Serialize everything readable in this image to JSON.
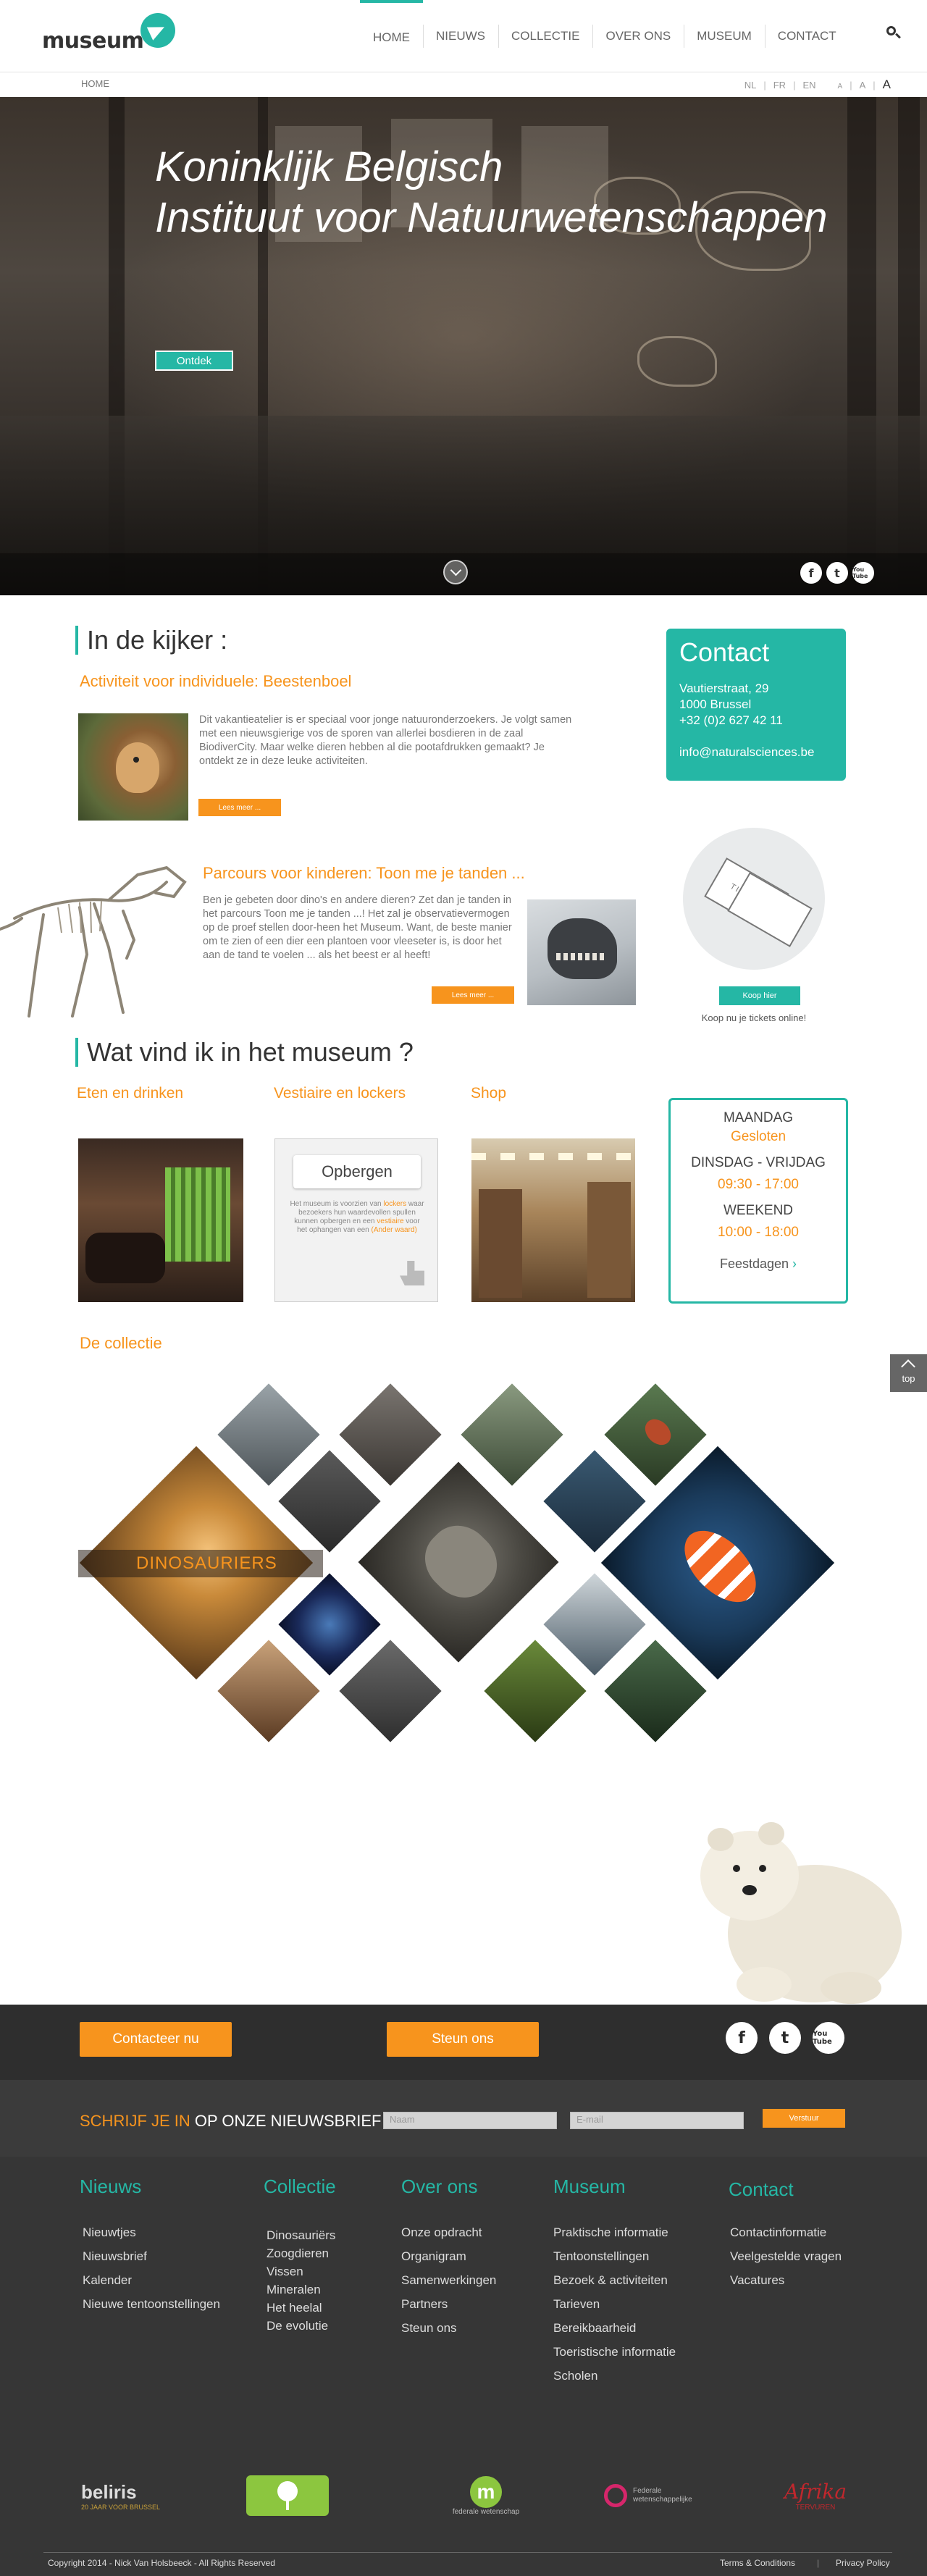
{
  "header": {
    "logo_text": "museum",
    "nav": [
      "HOME",
      "NIEUWS",
      "COLLECTIE",
      "OVER ONS",
      "MUSEUM",
      "CONTACT"
    ],
    "active_nav": "HOME",
    "search_icon": "search-icon"
  },
  "subbar": {
    "breadcrumb": "HOME",
    "langs": [
      "NL",
      "FR",
      "EN"
    ],
    "font_sizes": [
      "A",
      "A",
      "A"
    ]
  },
  "hero": {
    "title_line1": "Koninklijk Belgisch",
    "title_line2": "Instituut voor Natuurwetenschappen",
    "button": "Ontdek",
    "social": [
      "f",
      "t",
      "You Tube"
    ]
  },
  "kijker": {
    "title": "In de kijker :",
    "items": [
      {
        "title": "Activiteit voor individuele: Beestenboel",
        "text": "Dit vakantieatelier is er speciaal voor jonge natuuronderzoekers. Je volgt samen met een nieuwsgierige vos de sporen van allerlei bosdieren in de zaal BiodiverCity. Maar welke dieren hebben al die pootafdrukken gemaakt? Je ontdekt ze in deze leuke activiteiten.",
        "button": "Lees meer ..."
      },
      {
        "title": "Parcours voor kinderen: Toon me je tanden ...",
        "text": "Ben je gebeten door dino's en andere dieren? Zet dan je tanden in het parcours Toon me je tanden ...! Het zal je observatievermogen op de proef stellen door-heen het Museum. Want, de beste manier om te zien of een dier een plantoen voor vleeseter is, is door het aan de tand te voelen ... als het beest er al heeft!",
        "button": "Lees meer ..."
      }
    ]
  },
  "contact": {
    "title": "Contact",
    "street": "Vautierstraat, 29",
    "city": "1000 Brussel",
    "phone": "+32 (0)2 627 42 11",
    "email": "info@naturalsciences.be"
  },
  "tickets": {
    "ticket_text": "TICKET",
    "button": "Koop hier",
    "note": "Koop nu je tickets online!"
  },
  "museum_section": {
    "title": "Wat vind ik in het museum ?",
    "categories": [
      "Eten en drinken",
      "Vestiaire en lockers",
      "Shop"
    ],
    "locker_title": "Opbergen",
    "locker_text_1": "Het museum is voorzien van",
    "locker_text_2": "lockers",
    "locker_text_3": "waar bezoekers hun waardevollen spullen kunnen opbergen",
    "locker_text_4": "en een",
    "locker_text_5": "vestiaire",
    "locker_text_6": "voor het ophangen van een",
    "locker_text_7": "(Ander waard)"
  },
  "hours": {
    "day1": "MAANDAG",
    "day1_value": "Gesloten",
    "day2": "DINSDAG - VRIJDAG",
    "day2_value": "09:30 - 17:00",
    "day3": "WEEKEND",
    "day3_value": "10:00 - 18:00",
    "holidays": "Feestdagen"
  },
  "collection": {
    "title": "De collectie",
    "featured": "DINOSAURIERS"
  },
  "top_button": "top",
  "footer": {
    "contact_btn": "Contacteer nu",
    "support_btn": "Steun ons",
    "social": [
      "f",
      "t",
      "You Tube"
    ],
    "newsletter_prefix": "SCHRIJF JE IN",
    "newsletter_suffix": "OP ONZE NIEUWSBRIEF",
    "name_placeholder": "Naam",
    "email_placeholder": "E-mail",
    "newsletter_btn": "Verstuur",
    "columns": [
      {
        "title": "Nieuws",
        "items": [
          "Nieuwtjes",
          "Nieuwsbrief",
          "Kalender",
          "Nieuwe tentoonstellingen"
        ]
      },
      {
        "title": "Collectie",
        "items": [
          "Dinosauriërs",
          "Zoogdieren",
          "Vissen",
          "Mineralen",
          "Het heelal",
          "De evolutie"
        ]
      },
      {
        "title": "Over ons",
        "items": [
          "Onze opdracht",
          "Organigram",
          "Samenwerkingen",
          "Partners",
          "Steun ons"
        ]
      },
      {
        "title": "Museum",
        "items": [
          "Praktische informatie",
          "Tentoonstellingen",
          "Bezoek & activiteiten",
          "Tarieven",
          "Bereikbaarheid",
          "Toeristische informatie",
          "Scholen"
        ]
      },
      {
        "title": "Contact",
        "items": [
          "Contactinformatie",
          "Veelgestelde vragen",
          "Vacatures"
        ]
      }
    ],
    "partners": [
      "beliris",
      "",
      "m",
      "Federale wetenschappelijke",
      "Afrika"
    ],
    "partner_sub_1": "20 JAAR VOOR BRUSSEL",
    "partner_sub_3": "federale wetenschap",
    "partner_sub_5": "TERVUREN",
    "copyright": "Copyright 2014 - Nick Van Holsbeeck - All Rights Reserved",
    "terms": "Terms & Conditions",
    "privacy": "Privacy Policy"
  },
  "colors": {
    "teal": "#25b7a5",
    "orange": "#f7941d",
    "dark": "#2e2e2e"
  }
}
